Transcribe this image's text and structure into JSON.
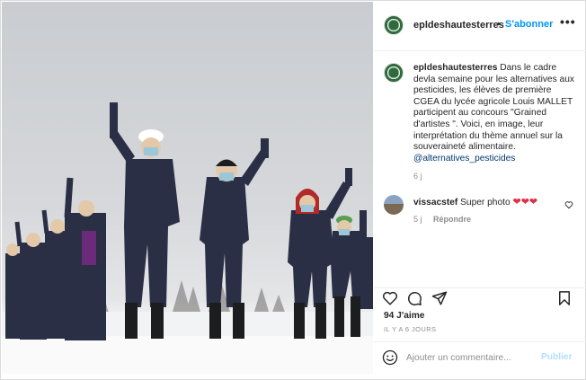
{
  "post": {
    "author": "epldeshautesterres",
    "follow_separator": "•",
    "follow_label": "S'abonner",
    "more_label": "•••",
    "caption": {
      "username": "epldeshautesterres",
      "text": " Dans le cadre devla semaine pour les alternatives aux pesticides, les élèves de première CGEA du lycée agricole Louis MALLET participent au concours \"Grained d'artistes \". Voici, en image, leur interprétation du thème annuel sur la souveraineté alimentaire. ",
      "mention": "@alternatives_pesticides",
      "time": "6 j"
    },
    "comments": [
      {
        "username": "vissacstef",
        "text": "Super photo",
        "emoji": "❤❤❤",
        "time": "5 j",
        "reply_label": "Répondre"
      }
    ],
    "likes": "94 J'aime",
    "posted_ago": "IL Y A 6 JOURS",
    "add_comment_placeholder": "Ajouter un commentaire...",
    "publish_label": "Publier"
  },
  "icons": {
    "avatar": "school-logo-avatar",
    "like": "heart-icon",
    "comment": "comment-icon",
    "share": "paper-plane-icon",
    "save": "bookmark-icon",
    "emoji": "smiley-icon"
  },
  "colors": {
    "link": "#0095f6",
    "mention": "#00376b",
    "secondary_text": "#8e8e8e",
    "heart": "#e02f45",
    "publish_disabled": "#b2dffc"
  }
}
